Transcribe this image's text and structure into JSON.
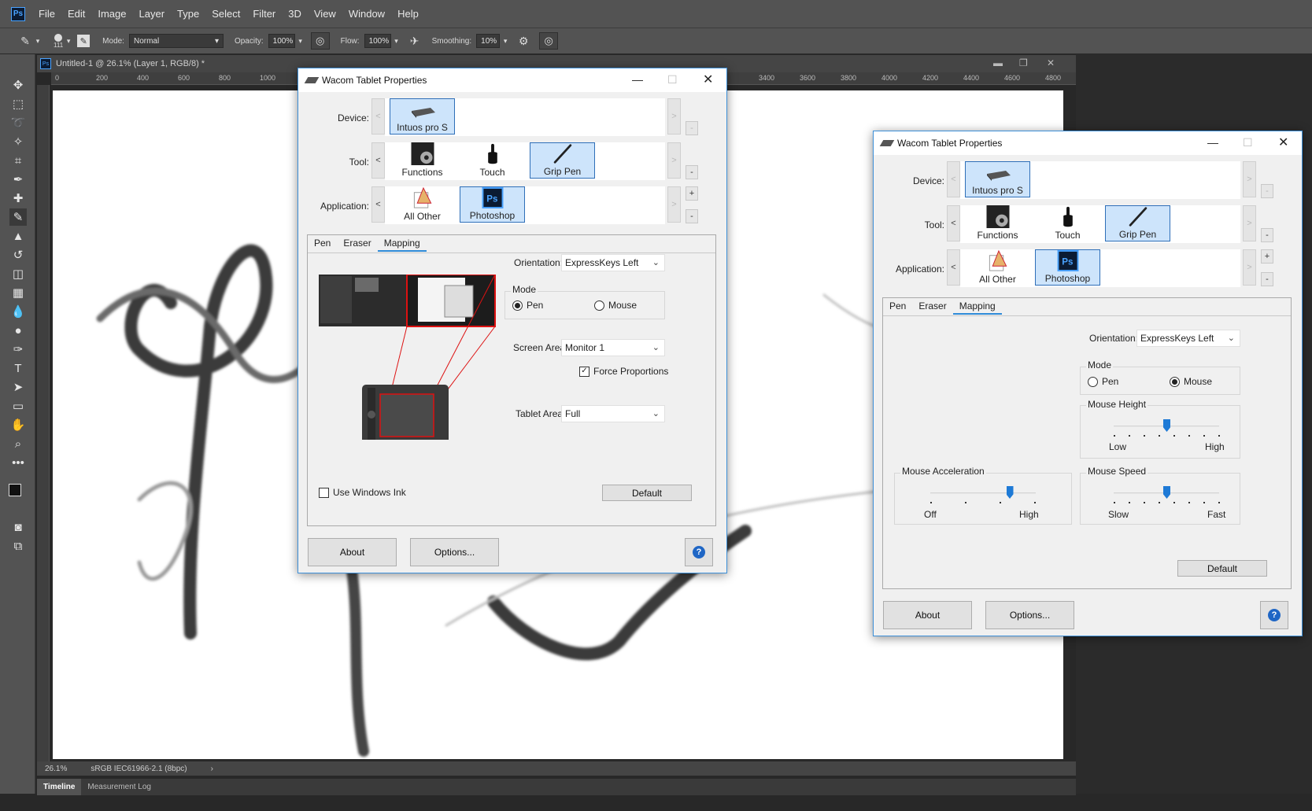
{
  "photoshop": {
    "menu": [
      "File",
      "Edit",
      "Image",
      "Layer",
      "Type",
      "Select",
      "Filter",
      "3D",
      "View",
      "Window",
      "Help"
    ],
    "options": {
      "brush_size": "111",
      "mode_label": "Mode:",
      "mode_value": "Normal",
      "opacity_label": "Opacity:",
      "opacity_value": "100%",
      "flow_label": "Flow:",
      "flow_value": "100%",
      "smoothing_label": "Smoothing:",
      "smoothing_value": "10%"
    },
    "doc_title": "Untitled-1 @ 26.1% (Layer 1, RGB/8) *",
    "ruler_ticks_left": [
      "0",
      "200",
      "400",
      "600",
      "800",
      "1000"
    ],
    "ruler_ticks_right": [
      "3400",
      "3600",
      "3800",
      "4000",
      "4200",
      "4400",
      "4600",
      "4800"
    ],
    "status_zoom": "26.1%",
    "status_profile": "sRGB IEC61966-2.1 (8bpc)",
    "panel_tabs": [
      "Timeline",
      "Measurement Log"
    ]
  },
  "dialog1": {
    "title": "Wacom Tablet Properties",
    "device_label": "Device:",
    "tool_label": "Tool:",
    "application_label": "Application:",
    "device": "Intuos pro S",
    "tools": [
      "Functions",
      "Touch",
      "Grip Pen"
    ],
    "applications": [
      "All Other",
      "Photoshop"
    ],
    "tabs": [
      "Pen",
      "Eraser",
      "Mapping"
    ],
    "orientation_label": "Orientation:",
    "orientation_value": "ExpressKeys Left",
    "mode_label": "Mode",
    "mode_pen": "Pen",
    "mode_mouse": "Mouse",
    "screen_area_label": "Screen Area:",
    "screen_area_value": "Monitor 1",
    "force_proportions": "Force Proportions",
    "tablet_area_label": "Tablet Area:",
    "tablet_area_value": "Full",
    "use_windows_ink": "Use Windows Ink",
    "default_btn": "Default",
    "about_btn": "About",
    "options_btn": "Options..."
  },
  "dialog2": {
    "title": "Wacom Tablet Properties",
    "device_label": "Device:",
    "tool_label": "Tool:",
    "application_label": "Application:",
    "device": "Intuos pro S",
    "tools": [
      "Functions",
      "Touch",
      "Grip Pen"
    ],
    "applications": [
      "All Other",
      "Photoshop"
    ],
    "tabs": [
      "Pen",
      "Eraser",
      "Mapping"
    ],
    "orientation_label": "Orientation:",
    "orientation_value": "ExpressKeys Left",
    "mode_label": "Mode",
    "mode_pen": "Pen",
    "mode_mouse": "Mouse",
    "mouse_height_label": "Mouse Height",
    "mouse_height_low": "Low",
    "mouse_height_high": "High",
    "mouse_accel_label": "Mouse Acceleration",
    "mouse_accel_off": "Off",
    "mouse_accel_high": "High",
    "mouse_speed_label": "Mouse Speed",
    "mouse_speed_slow": "Slow",
    "mouse_speed_fast": "Fast",
    "default_btn": "Default",
    "about_btn": "About",
    "options_btn": "Options..."
  },
  "colors": {
    "accent": "#2f8bd8",
    "selection": "#cde4fb",
    "ps_panel": "#535353",
    "slider": "#1e7ad6"
  },
  "slider_levels": {
    "mouse_height": 0.5,
    "mouse_accel": 0.75,
    "mouse_speed": 0.5
  }
}
